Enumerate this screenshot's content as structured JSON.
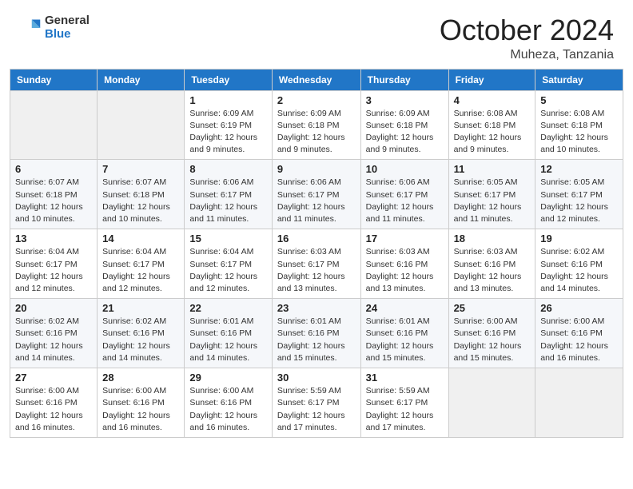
{
  "header": {
    "logo_general": "General",
    "logo_blue": "Blue",
    "month_title": "October 2024",
    "location": "Muheza, Tanzania"
  },
  "calendar": {
    "weekdays": [
      "Sunday",
      "Monday",
      "Tuesday",
      "Wednesday",
      "Thursday",
      "Friday",
      "Saturday"
    ],
    "weeks": [
      [
        {
          "day": "",
          "info": ""
        },
        {
          "day": "",
          "info": ""
        },
        {
          "day": "1",
          "info": "Sunrise: 6:09 AM\nSunset: 6:19 PM\nDaylight: 12 hours and 9 minutes."
        },
        {
          "day": "2",
          "info": "Sunrise: 6:09 AM\nSunset: 6:18 PM\nDaylight: 12 hours and 9 minutes."
        },
        {
          "day": "3",
          "info": "Sunrise: 6:09 AM\nSunset: 6:18 PM\nDaylight: 12 hours and 9 minutes."
        },
        {
          "day": "4",
          "info": "Sunrise: 6:08 AM\nSunset: 6:18 PM\nDaylight: 12 hours and 9 minutes."
        },
        {
          "day": "5",
          "info": "Sunrise: 6:08 AM\nSunset: 6:18 PM\nDaylight: 12 hours and 10 minutes."
        }
      ],
      [
        {
          "day": "6",
          "info": "Sunrise: 6:07 AM\nSunset: 6:18 PM\nDaylight: 12 hours and 10 minutes."
        },
        {
          "day": "7",
          "info": "Sunrise: 6:07 AM\nSunset: 6:18 PM\nDaylight: 12 hours and 10 minutes."
        },
        {
          "day": "8",
          "info": "Sunrise: 6:06 AM\nSunset: 6:17 PM\nDaylight: 12 hours and 11 minutes."
        },
        {
          "day": "9",
          "info": "Sunrise: 6:06 AM\nSunset: 6:17 PM\nDaylight: 12 hours and 11 minutes."
        },
        {
          "day": "10",
          "info": "Sunrise: 6:06 AM\nSunset: 6:17 PM\nDaylight: 12 hours and 11 minutes."
        },
        {
          "day": "11",
          "info": "Sunrise: 6:05 AM\nSunset: 6:17 PM\nDaylight: 12 hours and 11 minutes."
        },
        {
          "day": "12",
          "info": "Sunrise: 6:05 AM\nSunset: 6:17 PM\nDaylight: 12 hours and 12 minutes."
        }
      ],
      [
        {
          "day": "13",
          "info": "Sunrise: 6:04 AM\nSunset: 6:17 PM\nDaylight: 12 hours and 12 minutes."
        },
        {
          "day": "14",
          "info": "Sunrise: 6:04 AM\nSunset: 6:17 PM\nDaylight: 12 hours and 12 minutes."
        },
        {
          "day": "15",
          "info": "Sunrise: 6:04 AM\nSunset: 6:17 PM\nDaylight: 12 hours and 12 minutes."
        },
        {
          "day": "16",
          "info": "Sunrise: 6:03 AM\nSunset: 6:17 PM\nDaylight: 12 hours and 13 minutes."
        },
        {
          "day": "17",
          "info": "Sunrise: 6:03 AM\nSunset: 6:16 PM\nDaylight: 12 hours and 13 minutes."
        },
        {
          "day": "18",
          "info": "Sunrise: 6:03 AM\nSunset: 6:16 PM\nDaylight: 12 hours and 13 minutes."
        },
        {
          "day": "19",
          "info": "Sunrise: 6:02 AM\nSunset: 6:16 PM\nDaylight: 12 hours and 14 minutes."
        }
      ],
      [
        {
          "day": "20",
          "info": "Sunrise: 6:02 AM\nSunset: 6:16 PM\nDaylight: 12 hours and 14 minutes."
        },
        {
          "day": "21",
          "info": "Sunrise: 6:02 AM\nSunset: 6:16 PM\nDaylight: 12 hours and 14 minutes."
        },
        {
          "day": "22",
          "info": "Sunrise: 6:01 AM\nSunset: 6:16 PM\nDaylight: 12 hours and 14 minutes."
        },
        {
          "day": "23",
          "info": "Sunrise: 6:01 AM\nSunset: 6:16 PM\nDaylight: 12 hours and 15 minutes."
        },
        {
          "day": "24",
          "info": "Sunrise: 6:01 AM\nSunset: 6:16 PM\nDaylight: 12 hours and 15 minutes."
        },
        {
          "day": "25",
          "info": "Sunrise: 6:00 AM\nSunset: 6:16 PM\nDaylight: 12 hours and 15 minutes."
        },
        {
          "day": "26",
          "info": "Sunrise: 6:00 AM\nSunset: 6:16 PM\nDaylight: 12 hours and 16 minutes."
        }
      ],
      [
        {
          "day": "27",
          "info": "Sunrise: 6:00 AM\nSunset: 6:16 PM\nDaylight: 12 hours and 16 minutes."
        },
        {
          "day": "28",
          "info": "Sunrise: 6:00 AM\nSunset: 6:16 PM\nDaylight: 12 hours and 16 minutes."
        },
        {
          "day": "29",
          "info": "Sunrise: 6:00 AM\nSunset: 6:16 PM\nDaylight: 12 hours and 16 minutes."
        },
        {
          "day": "30",
          "info": "Sunrise: 5:59 AM\nSunset: 6:17 PM\nDaylight: 12 hours and 17 minutes."
        },
        {
          "day": "31",
          "info": "Sunrise: 5:59 AM\nSunset: 6:17 PM\nDaylight: 12 hours and 17 minutes."
        },
        {
          "day": "",
          "info": ""
        },
        {
          "day": "",
          "info": ""
        }
      ]
    ]
  }
}
